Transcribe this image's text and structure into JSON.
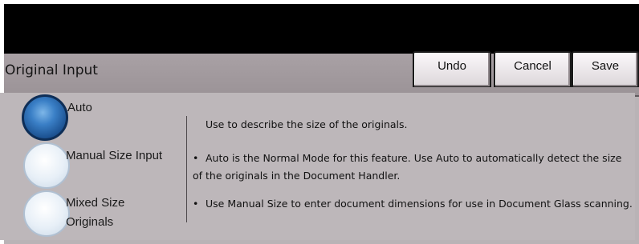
{
  "header": {
    "title": "Original Input",
    "buttons": {
      "undo": "Undo",
      "cancel": "Cancel",
      "save": "Save"
    }
  },
  "options": [
    {
      "label": "Auto",
      "selected": true
    },
    {
      "label": "Manual Size Input",
      "selected": false
    },
    {
      "label": "Mixed Size Originals",
      "selected": false
    }
  ],
  "description": {
    "intro": "Use to describe the size of the originals.",
    "bullets": [
      "Auto is the Normal Mode for this feature.  Use Auto to automatically detect the size of the originals in the Document Handler.",
      "Use Manual Size to enter document dimensions for use in Document Glass scanning."
    ]
  },
  "colors": {
    "selected_radio": "#1a4f8e",
    "unselected_radio": "#e7eff7"
  }
}
